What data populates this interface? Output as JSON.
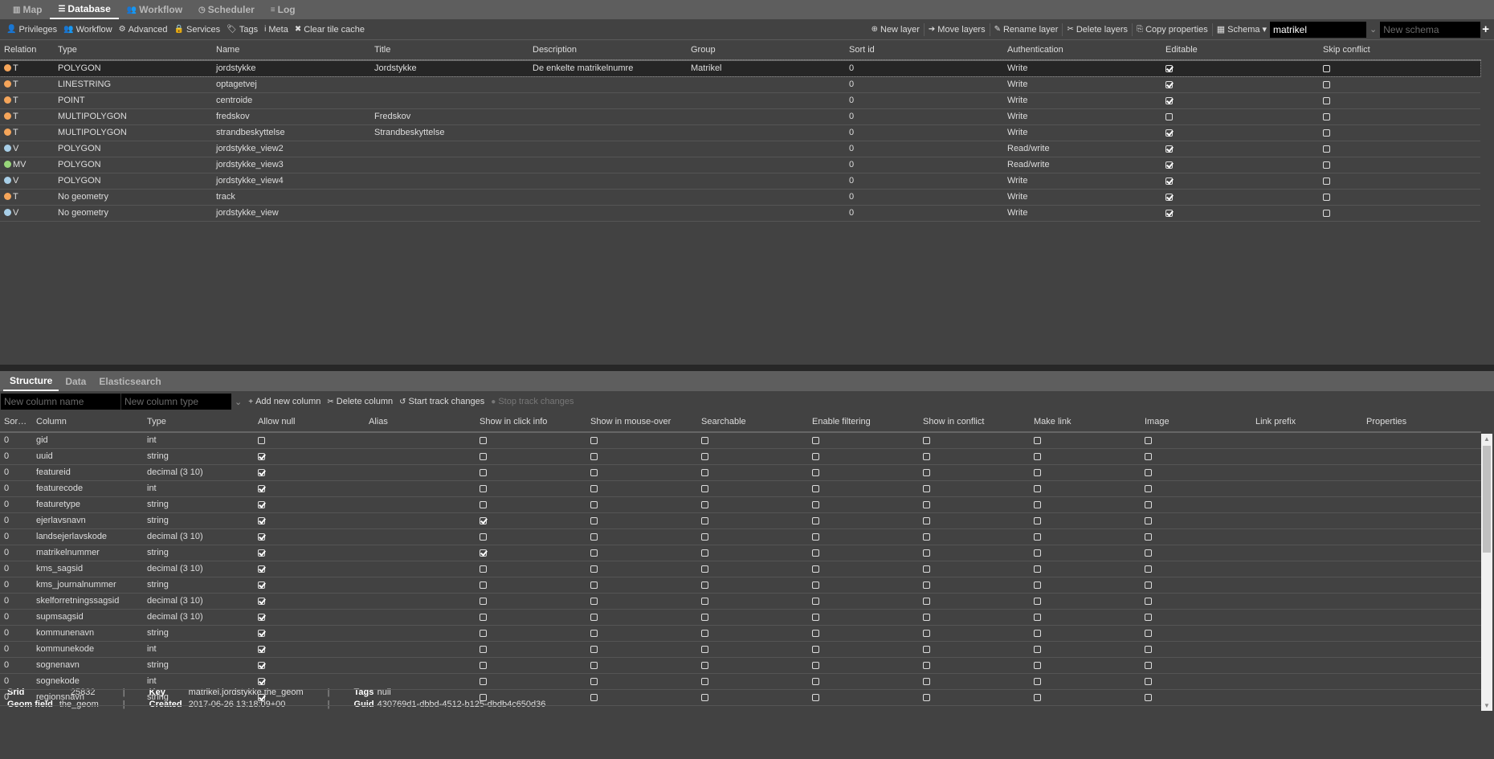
{
  "top_tabs": [
    {
      "label": "Map",
      "icon": "map-icon",
      "active": false
    },
    {
      "label": "Database",
      "icon": "database-icon",
      "active": true
    },
    {
      "label": "Workflow",
      "icon": "users-icon",
      "active": false
    },
    {
      "label": "Scheduler",
      "icon": "clock-icon",
      "active": false
    },
    {
      "label": "Log",
      "icon": "list-icon",
      "active": false
    }
  ],
  "toolbar_left": [
    {
      "label": "Privileges",
      "icon": "user-icon"
    },
    {
      "label": "Workflow",
      "icon": "users-icon"
    },
    {
      "label": "Advanced",
      "icon": "cogs-icon"
    },
    {
      "label": "Services",
      "icon": "lock-icon"
    },
    {
      "label": "Tags",
      "icon": "tags-icon"
    },
    {
      "label": "Meta",
      "icon": "info-icon"
    },
    {
      "label": "Clear tile cache",
      "icon": "close-icon"
    }
  ],
  "toolbar_right": [
    {
      "label": "New layer",
      "icon": "plus-circle-icon"
    },
    {
      "label": "Move layers",
      "icon": "arrow-right-icon"
    },
    {
      "label": "Rename layer",
      "icon": "pencil-icon"
    },
    {
      "label": "Delete layers",
      "icon": "scissors-icon"
    },
    {
      "label": "Copy properties",
      "icon": "copy-icon"
    }
  ],
  "schema": {
    "label": "Schema",
    "value": "matrikel",
    "new_placeholder": "New schema"
  },
  "layers": {
    "headers": [
      "Relation",
      "Type",
      "Name",
      "Title",
      "Description",
      "Group",
      "Sort id",
      "Authentication",
      "Editable",
      "Skip conflict"
    ],
    "rows": [
      {
        "relation": "T",
        "color": "#f5a55a",
        "type": "POLYGON",
        "name": "jordstykke",
        "title": "Jordstykke",
        "description": "De enkelte matrikelnumre",
        "group": "Matrikel",
        "sort_id": "0",
        "auth": "Write",
        "editable": true,
        "skip": false,
        "selected": true
      },
      {
        "relation": "T",
        "color": "#f5a55a",
        "type": "LINESTRING",
        "name": "optagetvej",
        "title": "",
        "description": "",
        "group": "",
        "sort_id": "0",
        "auth": "Write",
        "editable": true,
        "skip": false
      },
      {
        "relation": "T",
        "color": "#f5a55a",
        "type": "POINT",
        "name": "centroide",
        "title": "",
        "description": "",
        "group": "",
        "sort_id": "0",
        "auth": "Write",
        "editable": true,
        "skip": false
      },
      {
        "relation": "T",
        "color": "#f5a55a",
        "type": "MULTIPOLYGON",
        "name": "fredskov",
        "title": "Fredskov",
        "description": "",
        "group": "",
        "sort_id": "0",
        "auth": "Write",
        "editable": false,
        "skip": false
      },
      {
        "relation": "T",
        "color": "#f5a55a",
        "type": "MULTIPOLYGON",
        "name": "strandbeskyttelse",
        "title": "Strandbeskyttelse",
        "description": "",
        "group": "",
        "sort_id": "0",
        "auth": "Write",
        "editable": true,
        "skip": false
      },
      {
        "relation": "V",
        "color": "#a8cfe8",
        "type": "POLYGON",
        "name": "jordstykke_view2",
        "title": "",
        "description": "",
        "group": "",
        "sort_id": "0",
        "auth": "Read/write",
        "editable": true,
        "skip": false
      },
      {
        "relation": "MV",
        "color": "#98d67a",
        "type": "POLYGON",
        "name": "jordstykke_view3",
        "title": "",
        "description": "",
        "group": "",
        "sort_id": "0",
        "auth": "Read/write",
        "editable": true,
        "skip": false
      },
      {
        "relation": "V",
        "color": "#a8cfe8",
        "type": "POLYGON",
        "name": "jordstykke_view4",
        "title": "",
        "description": "",
        "group": "",
        "sort_id": "0",
        "auth": "Write",
        "editable": true,
        "skip": false
      },
      {
        "relation": "T",
        "color": "#f5a55a",
        "type": "No geometry",
        "name": "track",
        "title": "",
        "description": "",
        "group": "",
        "sort_id": "0",
        "auth": "Write",
        "editable": true,
        "skip": false
      },
      {
        "relation": "V",
        "color": "#a8cfe8",
        "type": "No geometry",
        "name": "jordstykke_view",
        "title": "",
        "description": "",
        "group": "",
        "sort_id": "0",
        "auth": "Write",
        "editable": true,
        "skip": false
      }
    ]
  },
  "bottom_tabs": [
    {
      "label": "Structure",
      "active": true
    },
    {
      "label": "Data",
      "active": false
    },
    {
      "label": "Elasticsearch",
      "active": false
    }
  ],
  "column_tools": {
    "name_placeholder": "New column name",
    "type_placeholder": "New column type",
    "buttons": [
      {
        "label": "Add new column",
        "icon": "plus-icon",
        "enabled": true
      },
      {
        "label": "Delete column",
        "icon": "scissors-icon",
        "enabled": true
      },
      {
        "label": "Start track changes",
        "icon": "history-icon",
        "enabled": true
      },
      {
        "label": "Stop track changes",
        "icon": "stop-icon",
        "enabled": false
      }
    ]
  },
  "structure": {
    "headers": [
      "Sort ...",
      "Column",
      "Type",
      "Allow null",
      "Alias",
      "Show in click info",
      "Show in mouse-over",
      "Searchable",
      "Enable filtering",
      "Show in conflict",
      "Make link",
      "Image",
      "Link prefix",
      "Properties"
    ],
    "rows": [
      {
        "sort": "0",
        "column": "gid",
        "type": "int",
        "allow_null": false,
        "alias": "",
        "click": false,
        "mouse": false,
        "search": false,
        "filter": false,
        "conflict": false,
        "link": false,
        "image": false,
        "link_prefix": "",
        "properties": ""
      },
      {
        "sort": "0",
        "column": "uuid",
        "type": "string",
        "allow_null": true,
        "alias": "",
        "click": false,
        "mouse": false,
        "search": false,
        "filter": false,
        "conflict": false,
        "link": false,
        "image": false,
        "link_prefix": "",
        "properties": ""
      },
      {
        "sort": "0",
        "column": "featureid",
        "type": "decimal (3 10)",
        "allow_null": true,
        "alias": "",
        "click": false,
        "mouse": false,
        "search": false,
        "filter": false,
        "conflict": false,
        "link": false,
        "image": false,
        "link_prefix": "",
        "properties": ""
      },
      {
        "sort": "0",
        "column": "featurecode",
        "type": "int",
        "allow_null": true,
        "alias": "",
        "click": false,
        "mouse": false,
        "search": false,
        "filter": false,
        "conflict": false,
        "link": false,
        "image": false,
        "link_prefix": "",
        "properties": ""
      },
      {
        "sort": "0",
        "column": "featuretype",
        "type": "string",
        "allow_null": true,
        "alias": "",
        "click": false,
        "mouse": false,
        "search": false,
        "filter": false,
        "conflict": false,
        "link": false,
        "image": false,
        "link_prefix": "",
        "properties": ""
      },
      {
        "sort": "0",
        "column": "ejerlavsnavn",
        "type": "string",
        "allow_null": true,
        "alias": "",
        "click": true,
        "mouse": false,
        "search": false,
        "filter": false,
        "conflict": false,
        "link": false,
        "image": false,
        "link_prefix": "",
        "properties": ""
      },
      {
        "sort": "0",
        "column": "landsejerlavskode",
        "type": "decimal (3 10)",
        "allow_null": true,
        "alias": "",
        "click": false,
        "mouse": false,
        "search": false,
        "filter": false,
        "conflict": false,
        "link": false,
        "image": false,
        "link_prefix": "",
        "properties": ""
      },
      {
        "sort": "0",
        "column": "matrikelnummer",
        "type": "string",
        "allow_null": true,
        "alias": "",
        "click": true,
        "mouse": false,
        "search": false,
        "filter": false,
        "conflict": false,
        "link": false,
        "image": false,
        "link_prefix": "",
        "properties": ""
      },
      {
        "sort": "0",
        "column": "kms_sagsid",
        "type": "decimal (3 10)",
        "allow_null": true,
        "alias": "",
        "click": false,
        "mouse": false,
        "search": false,
        "filter": false,
        "conflict": false,
        "link": false,
        "image": false,
        "link_prefix": "",
        "properties": ""
      },
      {
        "sort": "0",
        "column": "kms_journalnummer",
        "type": "string",
        "allow_null": true,
        "alias": "",
        "click": false,
        "mouse": false,
        "search": false,
        "filter": false,
        "conflict": false,
        "link": false,
        "image": false,
        "link_prefix": "",
        "properties": ""
      },
      {
        "sort": "0",
        "column": "skelforretningssagsid",
        "type": "decimal (3 10)",
        "allow_null": true,
        "alias": "",
        "click": false,
        "mouse": false,
        "search": false,
        "filter": false,
        "conflict": false,
        "link": false,
        "image": false,
        "link_prefix": "",
        "properties": ""
      },
      {
        "sort": "0",
        "column": "supmsagsid",
        "type": "decimal (3 10)",
        "allow_null": true,
        "alias": "",
        "click": false,
        "mouse": false,
        "search": false,
        "filter": false,
        "conflict": false,
        "link": false,
        "image": false,
        "link_prefix": "",
        "properties": ""
      },
      {
        "sort": "0",
        "column": "kommunenavn",
        "type": "string",
        "allow_null": true,
        "alias": "",
        "click": false,
        "mouse": false,
        "search": false,
        "filter": false,
        "conflict": false,
        "link": false,
        "image": false,
        "link_prefix": "",
        "properties": ""
      },
      {
        "sort": "0",
        "column": "kommunekode",
        "type": "int",
        "allow_null": true,
        "alias": "",
        "click": false,
        "mouse": false,
        "search": false,
        "filter": false,
        "conflict": false,
        "link": false,
        "image": false,
        "link_prefix": "",
        "properties": ""
      },
      {
        "sort": "0",
        "column": "sognenavn",
        "type": "string",
        "allow_null": true,
        "alias": "",
        "click": false,
        "mouse": false,
        "search": false,
        "filter": false,
        "conflict": false,
        "link": false,
        "image": false,
        "link_prefix": "",
        "properties": ""
      },
      {
        "sort": "0",
        "column": "sognekode",
        "type": "int",
        "allow_null": true,
        "alias": "",
        "click": false,
        "mouse": false,
        "search": false,
        "filter": false,
        "conflict": false,
        "link": false,
        "image": false,
        "link_prefix": "",
        "properties": ""
      },
      {
        "sort": "0",
        "column": "regionsnavn",
        "type": "string",
        "allow_null": true,
        "alias": "",
        "click": false,
        "mouse": false,
        "search": false,
        "filter": false,
        "conflict": false,
        "link": false,
        "image": false,
        "link_prefix": "",
        "properties": ""
      }
    ]
  },
  "info": {
    "srid_label": "Srid",
    "srid": "25832",
    "geom_label": "Geom field",
    "geom": "the_geom",
    "key_label": "Key",
    "key": "matrikel.jordstykke.the_geom",
    "created_label": "Created",
    "created": "2017-06-26 13:18:09+00",
    "tags_label": "Tags",
    "tags": "null",
    "guid_label": "Guid",
    "guid": "430769d1-dbbd-4512-b125-dbdb4c650d36"
  }
}
